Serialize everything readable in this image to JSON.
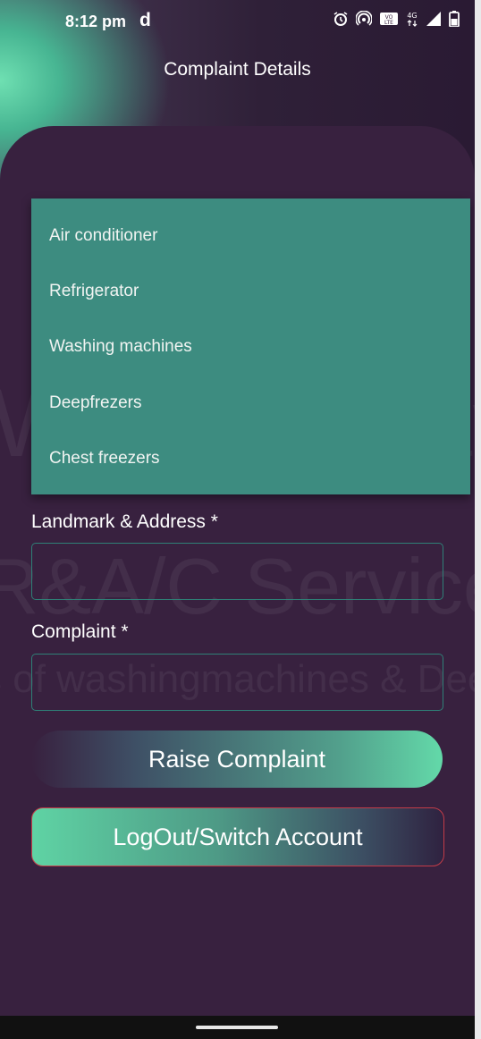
{
  "status_bar": {
    "time": "8:12 pm",
    "app_glyph": "d",
    "icons": [
      "alarm-icon",
      "hotspot-icon",
      "volte-icon",
      "4g-icon",
      "signal-icon",
      "battery-icon"
    ]
  },
  "header": {
    "title": "Complaint Details"
  },
  "dropdown": {
    "items": [
      "Air conditioner",
      "Refrigerator",
      "Washing machines",
      "Deepfrezers",
      "Chest freezers"
    ]
  },
  "form": {
    "landmark_label": "Landmark & Address *",
    "landmark_value": "",
    "complaint_label": "Complaint *",
    "complaint_value": ""
  },
  "buttons": {
    "raise": "Raise Complaint",
    "logout": "LogOut/Switch Account"
  },
  "watermark": {
    "line1": "West Godavari",
    "line2": "R&A/C Service",
    "line3": "s of washingmachines & Deepfreze"
  },
  "colors": {
    "background": "#38213f",
    "accent": "#63d9a9",
    "dropdown": "#3d8c80",
    "field_border": "#2f8077",
    "logout_border": "#c33c48"
  }
}
